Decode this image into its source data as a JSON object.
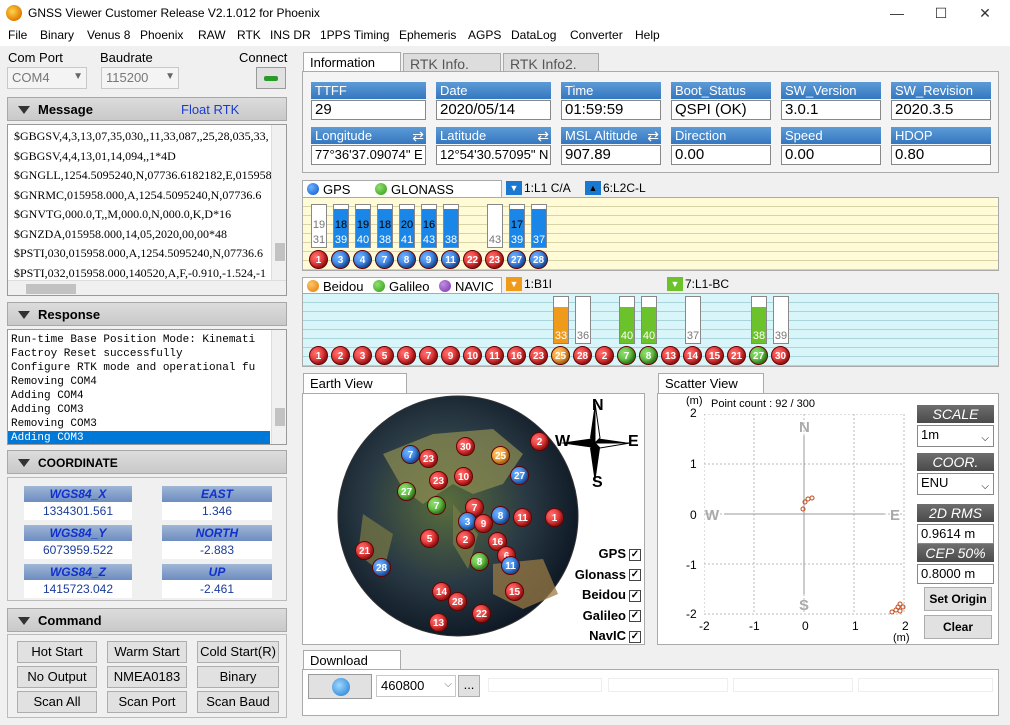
{
  "window": {
    "title": "GNSS Viewer Customer Release V2.1.012 for Phoenix",
    "min": "—",
    "max": "☐",
    "close": "✕"
  },
  "menu": [
    "File",
    "Binary",
    "Venus 8",
    "Phoenix",
    "RAW",
    "RTK",
    "INS DR",
    "1PPS Timing",
    "Ephemeris",
    "AGPS",
    "DataLog",
    "Converter",
    "Help"
  ],
  "connect": {
    "com_label": "Com Port",
    "com_value": "COM4",
    "baud_label": "Baudrate",
    "baud_value": "115200",
    "connect_label": "Connect"
  },
  "message": {
    "title": "Message",
    "status": "Float RTK",
    "lines": [
      "$GBGSV,4,3,13,07,35,030,,11,33,087,,25,28,035,33,",
      "$GBGSV,4,4,13,01,14,094,,1*4D",
      "$GNGLL,1254.5095240,N,07736.6182182,E,015958",
      "$GNRMC,015958.000,A,1254.5095240,N,07736.6",
      "$GNVTG,000.0,T,,M,000.0,N,000.0,K,D*16",
      "$GNZDA,015958.000,14,05,2020,00,00*48",
      "$PSTI,030,015958.000,A,1254.5095240,N,07736.6",
      "$PSTI,032,015958.000,140520,A,F,-0.910,-1.524,-1"
    ]
  },
  "response": {
    "title": "Response",
    "lines": [
      "Run-time Base Position Mode: Kinemati",
      "Factroy Reset successfully",
      "Configure RTK mode and operational fu",
      "Removing COM4",
      "Adding COM4",
      "Adding COM3",
      "Removing COM3",
      "Adding COM3"
    ]
  },
  "coordinate": {
    "title": "COORDINATE",
    "wgs84_x_label": "WGS84_X",
    "wgs84_x": "1334301.561",
    "east_label": "EAST",
    "east": "1.346",
    "wgs84_y_label": "WGS84_Y",
    "wgs84_y": "6073959.522",
    "north_label": "NORTH",
    "north": "-2.883",
    "wgs84_z_label": "WGS84_Z",
    "wgs84_z": "1415723.042",
    "up_label": "UP",
    "up": "-2.461"
  },
  "command": {
    "title": "Command",
    "buttons": [
      "Hot Start",
      "Warm Start",
      "Cold Start(R)",
      "No Output",
      "NMEA0183",
      "Binary",
      "Scan All",
      "Scan Port",
      "Scan Baud"
    ]
  },
  "tabs": [
    "Information",
    "RTK Info.",
    "RTK Info2."
  ],
  "info": {
    "ttff_label": "TTFF",
    "ttff": "29",
    "date_label": "Date",
    "date": "2020/05/14",
    "time_label": "Time",
    "time": "01:59:59",
    "boot_label": "Boot_Status",
    "boot": "QSPI (OK)",
    "swver_label": "SW_Version",
    "swver": "3.0.1",
    "swrev_label": "SW_Revision",
    "swrev": "2020.3.5",
    "lon_label": "Longitude",
    "lon": "77°36'37.09074\" E",
    "lat_label": "Latitude",
    "lat": "12°54'30.57095\" N",
    "msl_label": "MSL Altitude",
    "msl": "907.89",
    "dir_label": "Direction",
    "dir": "0.00",
    "speed_label": "Speed",
    "speed": "0.00",
    "hdop_label": "HDOP",
    "hdop": "0.80"
  },
  "gps_panel": {
    "tab_gps": "GPS",
    "tab_glonass": "GLONASS",
    "sig1": "1:L1 C/A",
    "sig2": "6:L2C-L",
    "bars": [
      {
        "top": "19",
        "bot": "31",
        "fill": 0,
        "prn": "1",
        "color": "red"
      },
      {
        "top": "18",
        "bot": "39",
        "fill": 1,
        "prn": "3",
        "color": "blue"
      },
      {
        "top": "19",
        "bot": "40",
        "fill": 1,
        "prn": "4",
        "color": "blue"
      },
      {
        "top": "18",
        "bot": "38",
        "fill": 1,
        "prn": "7",
        "color": "blue"
      },
      {
        "top": "20",
        "bot": "41",
        "fill": 1,
        "prn": "8",
        "color": "blue"
      },
      {
        "top": "16",
        "bot": "43",
        "fill": 1,
        "prn": "9",
        "color": "blue"
      },
      {
        "top": "",
        "bot": "38",
        "fill": 1,
        "prn": "11",
        "color": "blue"
      },
      {
        "top": "",
        "bot": "",
        "fill": 0,
        "prn": "22",
        "color": "red"
      },
      {
        "top": "",
        "bot": "43",
        "fill": 0,
        "prn": "23",
        "color": "red"
      },
      {
        "top": "17",
        "bot": "39",
        "fill": 1,
        "prn": "27",
        "color": "blue"
      },
      {
        "top": "",
        "bot": "37",
        "fill": 1,
        "prn": "28",
        "color": "blue"
      }
    ]
  },
  "bd_panel": {
    "tab_beidou": "Beidou",
    "tab_galileo": "Galileo",
    "tab_navic": "NAVIC",
    "sig1": "1:B1I",
    "sig2": "7:L1-BC",
    "bars": [
      {
        "val": "",
        "fill": 0,
        "prn": "1",
        "color": "red"
      },
      {
        "val": "",
        "fill": 0,
        "prn": "2",
        "color": "red"
      },
      {
        "val": "",
        "fill": 0,
        "prn": "3",
        "color": "red"
      },
      {
        "val": "",
        "fill": 0,
        "prn": "5",
        "color": "red"
      },
      {
        "val": "",
        "fill": 0,
        "prn": "6",
        "color": "red"
      },
      {
        "val": "",
        "fill": 0,
        "prn": "7",
        "color": "red"
      },
      {
        "val": "",
        "fill": 0,
        "prn": "9",
        "color": "red"
      },
      {
        "val": "",
        "fill": 0,
        "prn": "10",
        "color": "red"
      },
      {
        "val": "",
        "fill": 0,
        "prn": "11",
        "color": "red"
      },
      {
        "val": "",
        "fill": 0,
        "prn": "16",
        "color": "red"
      },
      {
        "val": "",
        "fill": 0,
        "prn": "23",
        "color": "red"
      },
      {
        "val": "33",
        "fill": 1,
        "prn": "25",
        "color": "orange"
      },
      {
        "val": "36",
        "fill": 0,
        "prn": "28",
        "color": "red"
      },
      {
        "val": "",
        "fill": 0,
        "prn": "2",
        "color": "red"
      },
      {
        "val": "40",
        "fill": 1,
        "prn": "7",
        "color": "green"
      },
      {
        "val": "40",
        "fill": 1,
        "prn": "8",
        "color": "green"
      },
      {
        "val": "",
        "fill": 0,
        "prn": "13",
        "color": "red"
      },
      {
        "val": "37",
        "fill": 0,
        "prn": "14",
        "color": "red"
      },
      {
        "val": "",
        "fill": 0,
        "prn": "15",
        "color": "red"
      },
      {
        "val": "",
        "fill": 0,
        "prn": "21",
        "color": "red"
      },
      {
        "val": "38",
        "fill": 1,
        "prn": "27",
        "color": "green"
      },
      {
        "val": "39",
        "fill": 0,
        "prn": "30",
        "color": "red"
      }
    ]
  },
  "earth": {
    "title": "Earth View",
    "N": "N",
    "S": "S",
    "E": "E",
    "W": "W",
    "checks": [
      "GPS",
      "Glonass",
      "Beidou",
      "Galileo",
      "NavIC"
    ]
  },
  "scatter": {
    "title": "Scatter View",
    "unit": "(m)",
    "point_count": "Point count : 92 / 300",
    "N": "N",
    "S": "S",
    "E": "E",
    "W": "W",
    "yticks": [
      "2",
      "1",
      "0",
      "-1",
      "-2"
    ],
    "xticks": [
      "-2",
      "-1",
      "0",
      "1",
      "2"
    ],
    "xunit": "(m)",
    "scale_label": "SCALE",
    "scale_value": "1m",
    "coor_label": "COOR.",
    "coor_value": "ENU",
    "rms_label": "2D RMS",
    "rms_value": "0.9614 m",
    "cep_label": "CEP 50%",
    "cep_value": "0.8000 m",
    "set_origin": "Set Origin",
    "clear": "Clear"
  },
  "download": {
    "title": "Download",
    "baud": "460800",
    "browse": "..."
  }
}
